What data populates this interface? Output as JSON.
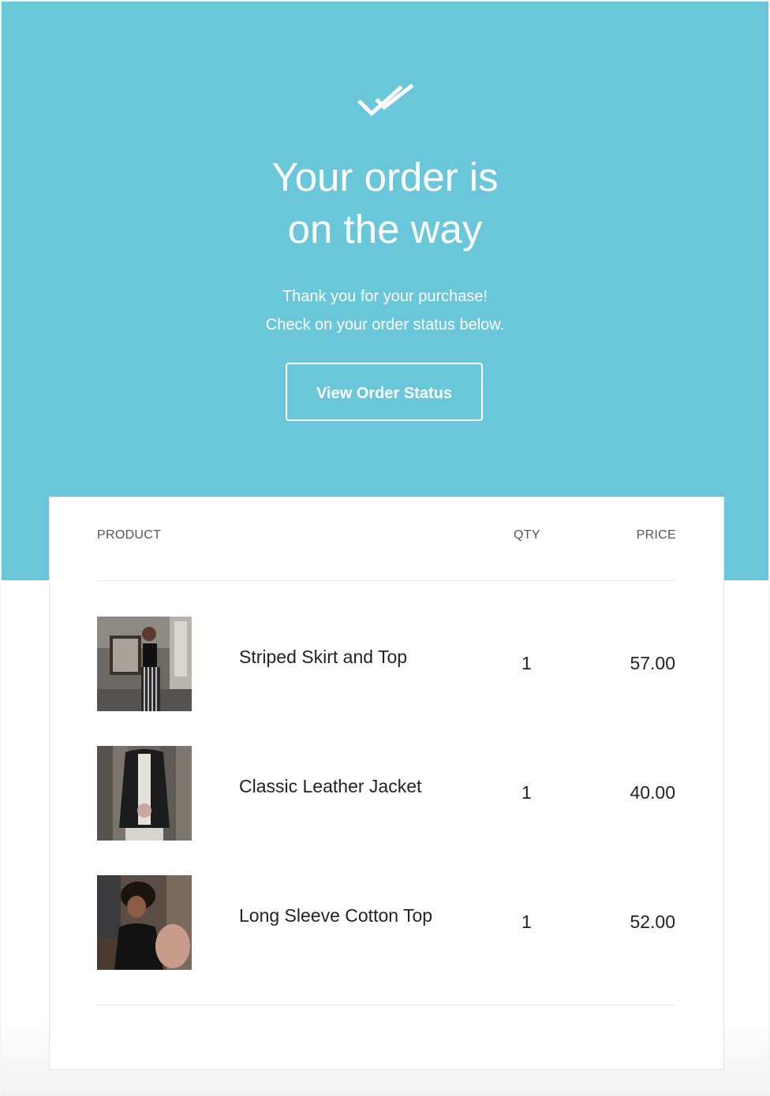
{
  "hero": {
    "background_color": "#6ac7da",
    "icon": "double-check-icon",
    "title_line1": "Your order is",
    "title_line2": "on the way",
    "subtitle_line1": "Thank you for your purchase!",
    "subtitle_line2": "Check on your order status below.",
    "button_label": "View Order Status"
  },
  "order_table": {
    "headers": {
      "product": "PRODUCT",
      "qty": "QTY",
      "price": "PRICE"
    },
    "items": [
      {
        "name": "Striped Skirt and Top",
        "qty": "1",
        "price": "57.00"
      },
      {
        "name": "Classic Leather Jacket",
        "qty": "1",
        "price": "40.00"
      },
      {
        "name": "Long Sleeve Cotton Top",
        "qty": "1",
        "price": "52.00"
      }
    ]
  }
}
